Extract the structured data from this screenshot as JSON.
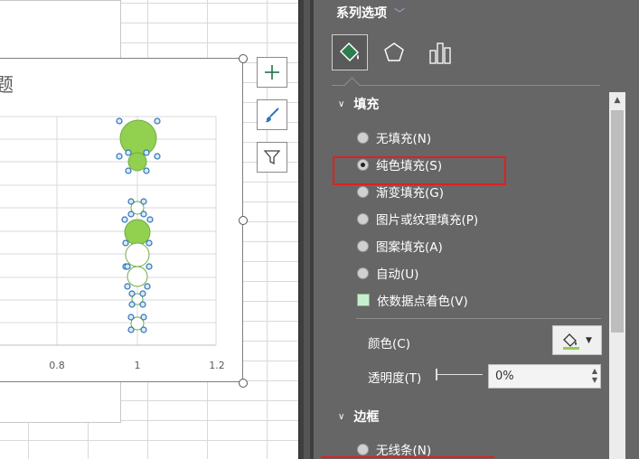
{
  "chart": {
    "title_fragment": "题",
    "x_ticks": [
      "0.8",
      "1",
      "1.2"
    ],
    "colors": {
      "accent_green": "#92d050",
      "outline_green": "#70ad47",
      "selection_blue": "#4472c4"
    }
  },
  "chart_side_buttons": [
    {
      "icon": "plus-icon"
    },
    {
      "icon": "brush-icon"
    },
    {
      "icon": "filter-icon"
    }
  ],
  "pane": {
    "title": "系列选项",
    "tabs": [
      {
        "icon": "paint-bucket-icon",
        "active": true
      },
      {
        "icon": "pentagon-icon",
        "active": false
      },
      {
        "icon": "bar-chart-icon",
        "active": false
      }
    ],
    "fill_section": {
      "title": "填充",
      "options": [
        "无填充(N)",
        "纯色填充(S)",
        "渐变填充(G)",
        "图片或纹理填充(P)",
        "图案填充(A)",
        "自动(U)"
      ],
      "selected": "纯色填充(S)",
      "vary_colors_label": "依数据点着色(V)",
      "color_label": "颜色(C)",
      "transparency_label": "透明度(T)",
      "transparency_value": "0%"
    },
    "border_section": {
      "title": "边框",
      "options": [
        "无线条(N)"
      ]
    },
    "colors": {
      "background": "#666666",
      "highlight": "#e02020"
    }
  }
}
